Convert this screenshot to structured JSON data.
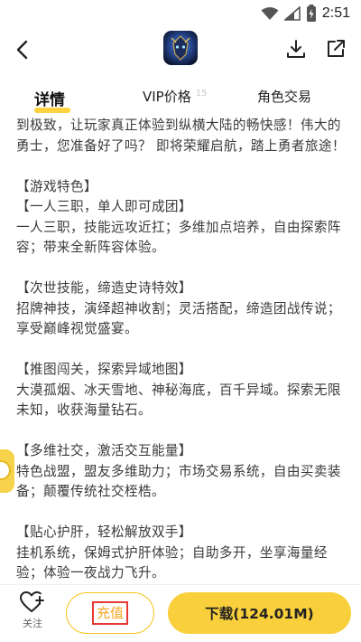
{
  "status": {
    "time": "2:51"
  },
  "header": {
    "back_icon": "chevron-left-icon",
    "app_icon": "game-app-icon",
    "download_icon": "download-icon",
    "share_icon": "share-icon"
  },
  "tabs": [
    {
      "label": "详情",
      "active": true
    },
    {
      "label": "VIP价格",
      "badge": "15"
    },
    {
      "label": "角色交易"
    }
  ],
  "content": {
    "intro": "到极致，让玩家真正体验到纵横大陆的畅快感！伟大的勇士，您准备好了吗？ 即将荣耀启航，踏上勇者旅途！",
    "features_title": "【游戏特色】",
    "sections": [
      {
        "title": "【一人三职，单人即可成团】",
        "body": "一人三职，技能远攻近扛；多维加点培养，自由探索阵容；带来全新阵容体验。"
      },
      {
        "title": "【次世技能，缔造史诗特效】",
        "body": "招牌神技，演绎超神收割；灵活搭配，缔造团战传说；享受巅峰视觉盛宴。"
      },
      {
        "title": "【推图闯关，探索异域地图】",
        "body": "大漠孤烟、冰天雪地、神秘海底，百千异域。探索无限未知，收获海量钻石。"
      },
      {
        "title": "【多维社交，激活交互能量】",
        "body": "特色战盟，盟友多维助力；市场交易系统，自由买卖装备；颠覆传统社交桎梏。"
      },
      {
        "title": "【贴心护肝，轻松解放双手】",
        "body": "挂机系统，保姆式护肝体验；自助多开，坐享海量经验；体验一夜战力飞升。"
      }
    ]
  },
  "bottom": {
    "follow_label": "关注",
    "recharge_label": "充值",
    "download_label": "下载(124.01M)"
  },
  "colors": {
    "accent": "#F9CF3B",
    "recharge_text": "#F5A623",
    "highlight_box": "#E53935"
  }
}
